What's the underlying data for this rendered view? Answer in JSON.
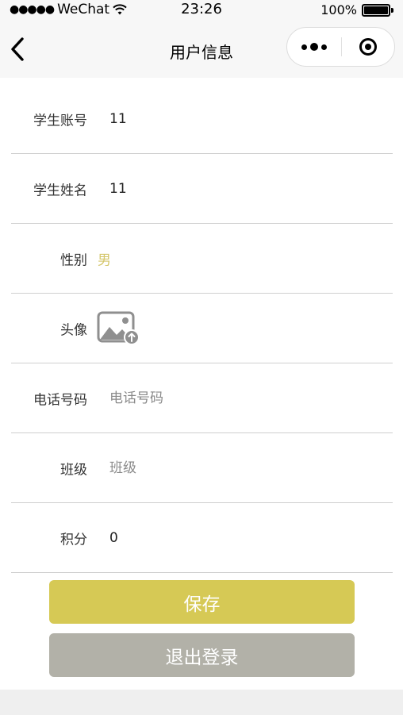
{
  "status_bar": {
    "signal": "●●●●●",
    "carrier": "WeChat",
    "time": "23:26",
    "battery": "100%"
  },
  "nav": {
    "title": "用户信息"
  },
  "form": {
    "rows": [
      {
        "label": "学生账号",
        "value": "11"
      },
      {
        "label": "学生姓名",
        "value": "11"
      },
      {
        "label": "性别",
        "value": "男"
      },
      {
        "label": "头像"
      },
      {
        "label": "电话号码",
        "placeholder": "电话号码",
        "value": ""
      },
      {
        "label": "班级",
        "placeholder": "班级",
        "value": ""
      },
      {
        "label": "积分",
        "value": "0"
      }
    ]
  },
  "buttons": {
    "save": "保存",
    "logout": "退出登录"
  },
  "colors": {
    "accent": "#d6c955",
    "gender_text": "#d4c66a",
    "logout_bg": "#b2b1a8"
  },
  "icons": [
    "wifi-icon",
    "battery-icon",
    "back-arrow-icon",
    "more-dots-icon",
    "close-target-icon",
    "image-upload-icon"
  ]
}
